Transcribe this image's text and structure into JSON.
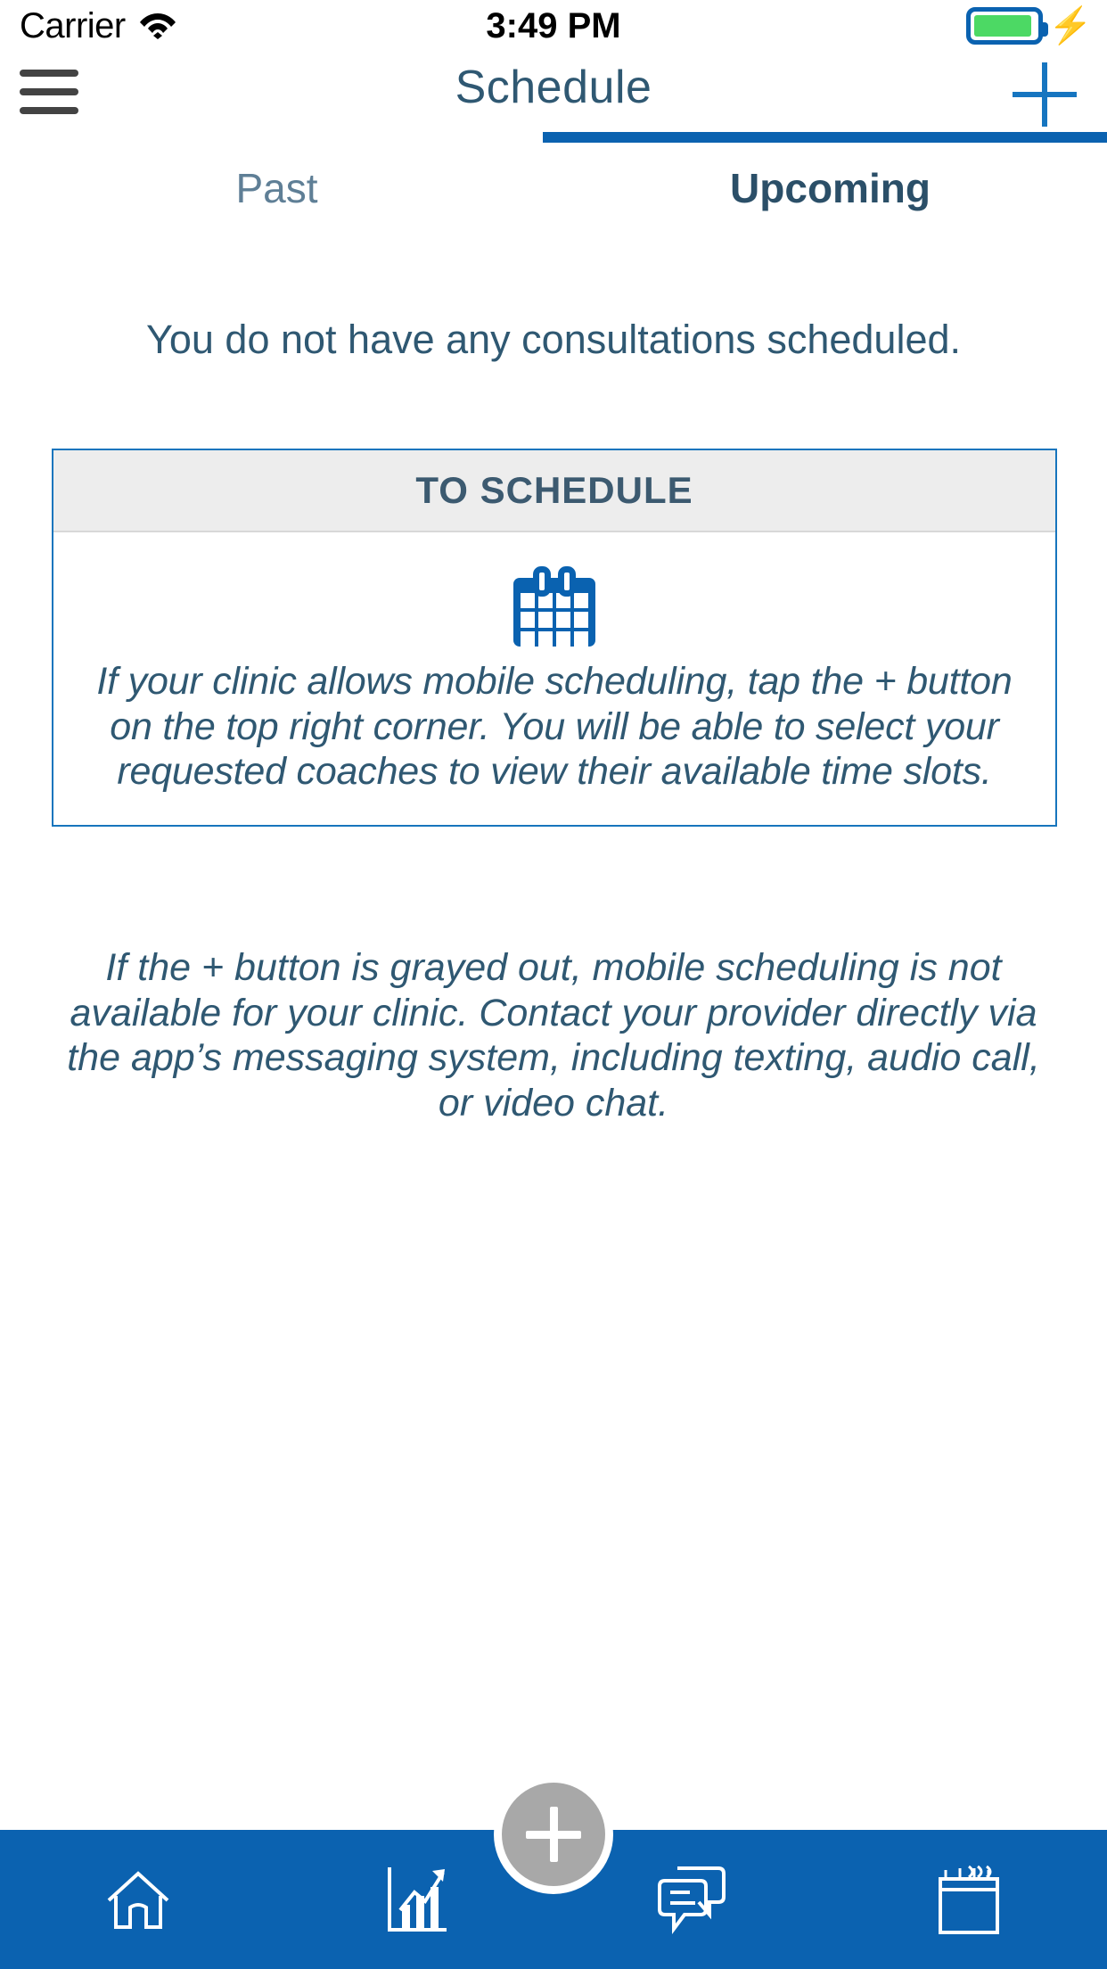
{
  "status_bar": {
    "carrier": "Carrier",
    "wifi_icon": "wifi-icon",
    "time": "3:49 PM",
    "battery_icon": "battery-icon",
    "charging_icon": "lightning-bolt-icon",
    "battery_color": "#4cd964",
    "battery_outline_color": "#0a62b0"
  },
  "navbar": {
    "menu_icon": "hamburger-menu-icon",
    "title": "Schedule",
    "add_icon": "plus-icon",
    "title_color": "#2f5872",
    "accent_color": "#1675c0"
  },
  "tabs": {
    "items": [
      {
        "label": "Past",
        "active": false
      },
      {
        "label": "Upcoming",
        "active": true
      }
    ],
    "indicator_color": "#0b62b0"
  },
  "main": {
    "empty_message": "You do not have any consultations scheduled.",
    "card": {
      "header_title": "TO SCHEDULE",
      "icon": "calendar-icon",
      "icon_color": "#0a62b0",
      "body_text": "If your clinic allows mobile scheduling, tap the + button on the top right corner. You will be able to select your requested coaches to view their available time slots.",
      "border_color": "#1775bd",
      "header_bg": "#ededed"
    },
    "note_text": "If the + button is grayed out, mobile scheduling is not available for your clinic. Contact your provider directly via the app’s messaging system, including texting, audio call, or video chat."
  },
  "tabbar": {
    "background": "#0b62b0",
    "items": [
      {
        "icon": "home-icon",
        "label": ""
      },
      {
        "icon": "chart-bar-icon",
        "label": ""
      },
      {
        "icon": "chat-bubbles-icon",
        "label": ""
      },
      {
        "icon": "calendar-notepad-icon",
        "label": ""
      }
    ],
    "fab": {
      "icon": "plus-icon",
      "color": "#a8a8a8"
    }
  }
}
